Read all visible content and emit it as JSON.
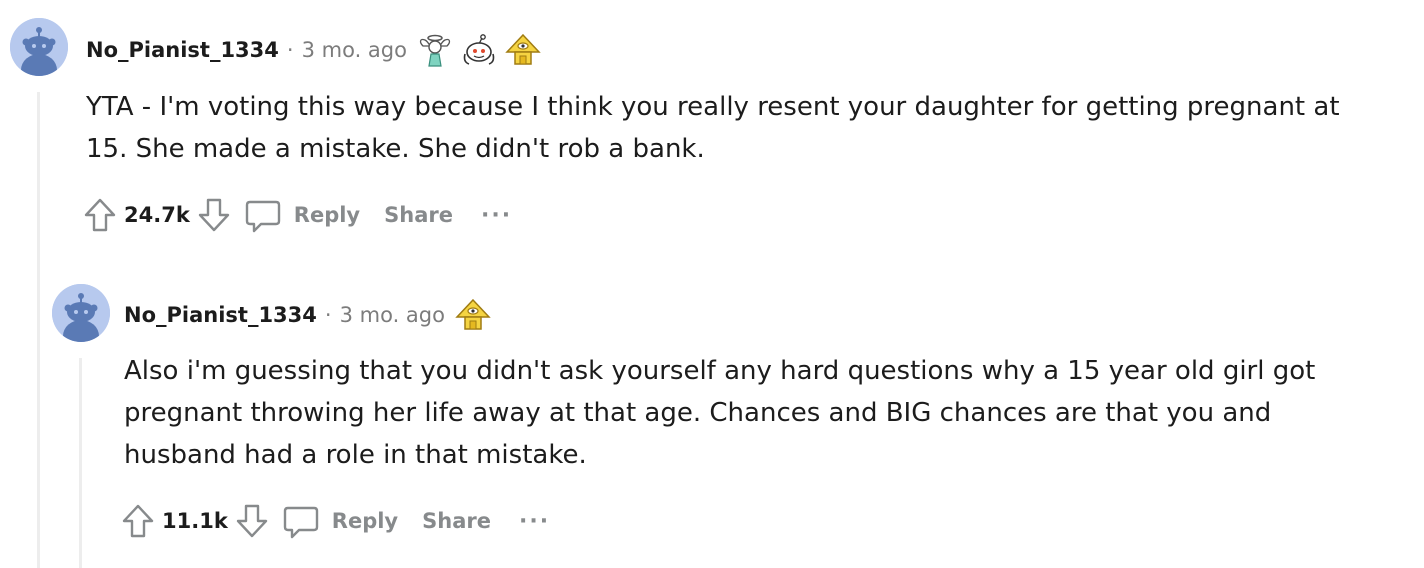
{
  "comments": [
    {
      "username": "No_Pianist_1334",
      "separator": "·",
      "age": "3 mo. ago",
      "awards": [
        "angel-wings-award-icon",
        "hugz-snoo-award-icon",
        "gold-pyramid-award-icon"
      ],
      "body": "YTA - I'm voting this way because I think you really resent your daughter for getting pregnant at 15. She made a mistake. She didn't rob a bank.",
      "score": "24.7k",
      "reply_label": "Reply",
      "share_label": "Share",
      "more_label": "···"
    },
    {
      "username": "No_Pianist_1334",
      "separator": "·",
      "age": "3 mo. ago",
      "awards": [
        "gold-pyramid-award-icon"
      ],
      "body": "Also i'm guessing that you didn't ask yourself any hard questions why a 15 year old girl got pregnant throwing her life away at that age. Chances and BIG chances are that you and husband had a role in that mistake.",
      "score": "11.1k",
      "reply_label": "Reply",
      "share_label": "Share",
      "more_label": "···"
    }
  ],
  "colors": {
    "avatar_bg": "#b7c9ee",
    "snoo": "#5a7ab5",
    "meta_gray": "#7c7c7c",
    "action_gray": "#878a8c",
    "thread_line": "#ededed"
  }
}
